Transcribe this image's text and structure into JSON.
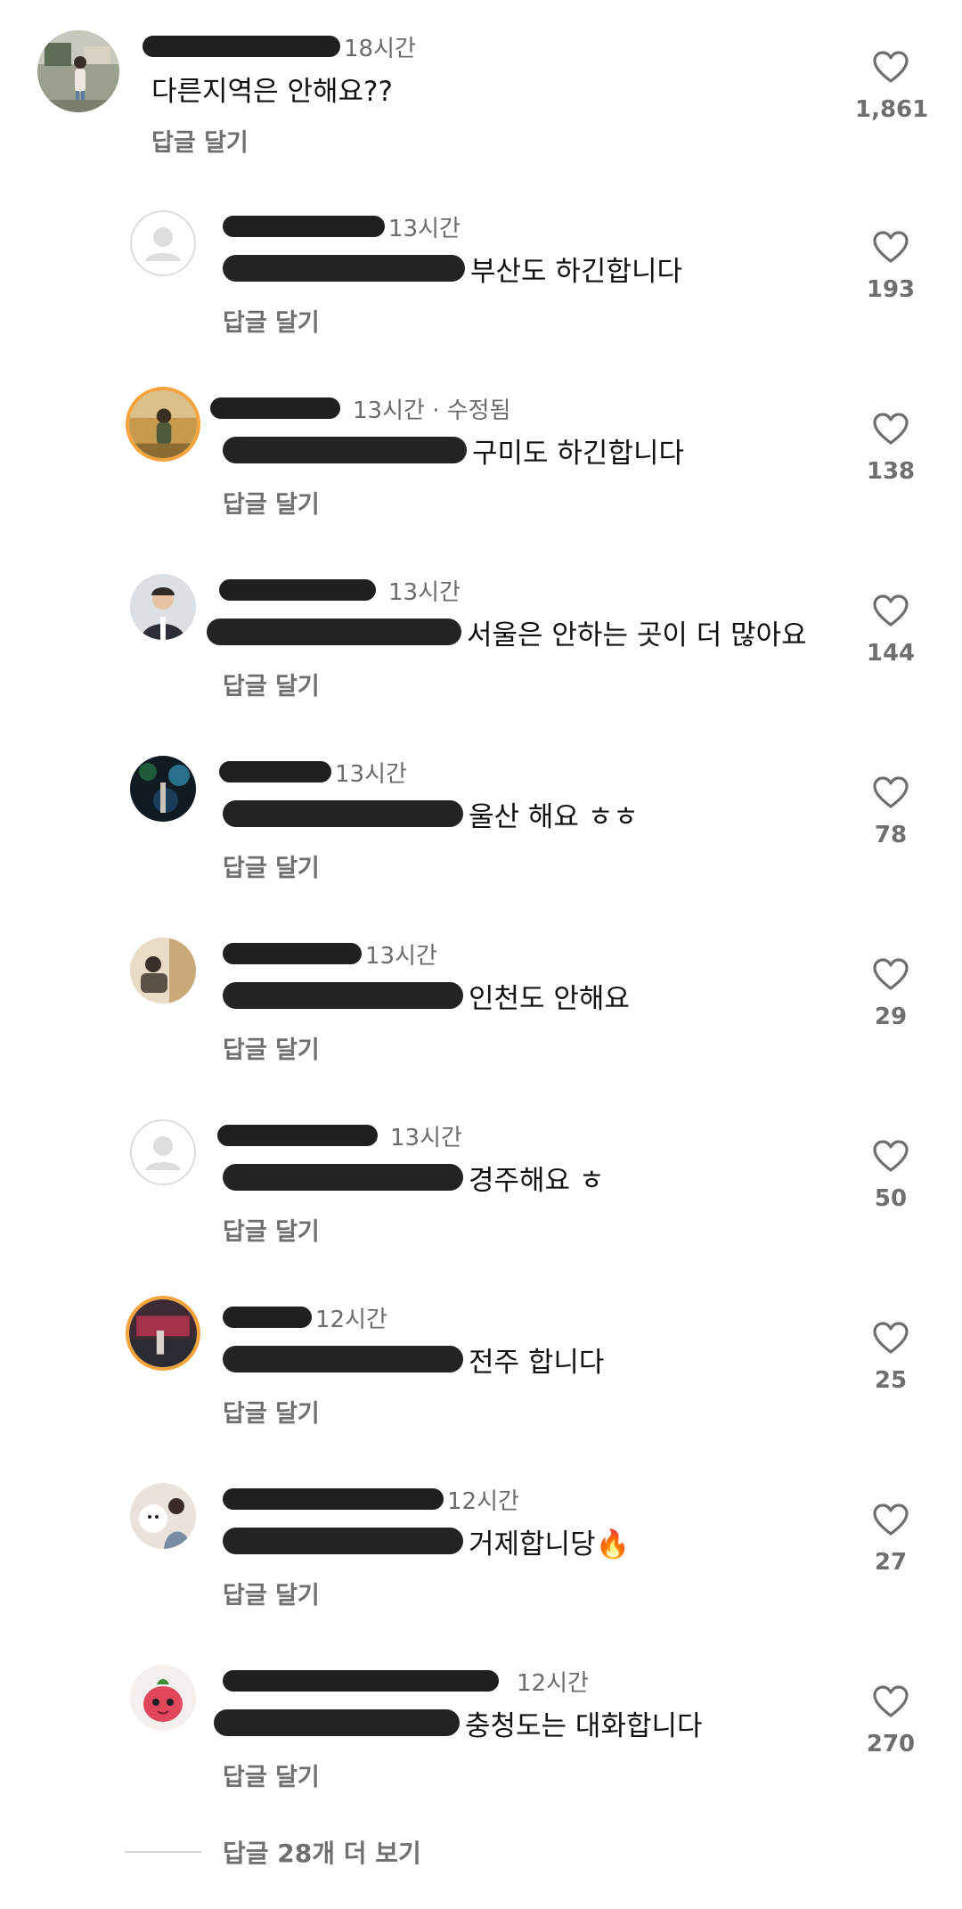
{
  "comments": [
    {
      "time": "18시간",
      "text": "다른지역은 안해요??",
      "reply_label": "답글 달기",
      "likes": "1,861",
      "avatar_icon": "user-photo-avatar"
    },
    {
      "time": "13시간",
      "text": "부산도 하긴합니다",
      "reply_label": "답글 달기",
      "likes": "193",
      "avatar_icon": "default-avatar-icon"
    },
    {
      "time": "13시간 · 수정됨",
      "text": "구미도 하긴합니다",
      "reply_label": "답글 달기",
      "likes": "138",
      "avatar_icon": "user-photo-avatar"
    },
    {
      "time": "13시간",
      "text": "서울은 안하는 곳이 더 많아요",
      "reply_label": "답글 달기",
      "likes": "144",
      "avatar_icon": "user-photo-avatar"
    },
    {
      "time": "13시간",
      "text": "울산 해요 ㅎㅎ",
      "reply_label": "답글 달기",
      "likes": "78",
      "avatar_icon": "user-photo-avatar"
    },
    {
      "time": "13시간",
      "text": "인천도 안해요",
      "reply_label": "답글 달기",
      "likes": "29",
      "avatar_icon": "user-photo-avatar"
    },
    {
      "time": "13시간",
      "text": "경주해요 ㅎ",
      "reply_label": "답글 달기",
      "likes": "50",
      "avatar_icon": "default-avatar-icon"
    },
    {
      "time": "12시간",
      "text": "전주 합니다",
      "reply_label": "답글 달기",
      "likes": "25",
      "avatar_icon": "user-photo-avatar"
    },
    {
      "time": "12시간",
      "text": "거제합니당🔥",
      "reply_label": "답글 달기",
      "likes": "27",
      "avatar_icon": "user-photo-avatar"
    },
    {
      "time": "12시간",
      "text": "충청도는 대화합니다",
      "reply_label": "답글 달기",
      "likes": "270",
      "avatar_icon": "user-photo-avatar"
    }
  ],
  "view_more_replies": "답글 28개 더 보기",
  "colors": {
    "redaction": "#1f1f1f",
    "like_icon": "#6f6f6f",
    "story_ring": "#f5a33c"
  }
}
